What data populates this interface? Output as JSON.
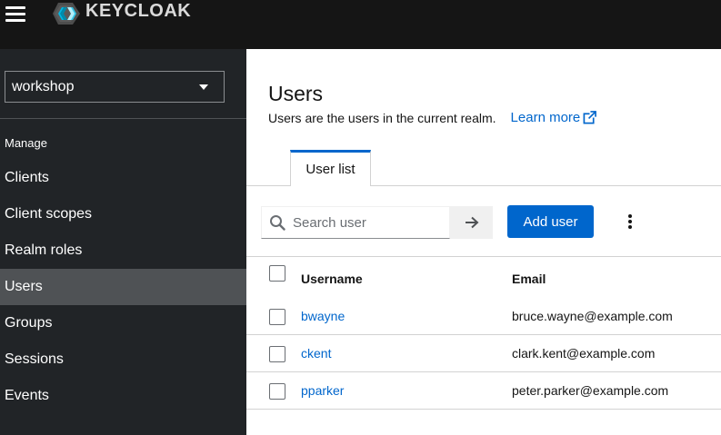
{
  "header": {
    "brand": "KEYCLOAK",
    "colors": {
      "background": "#151515",
      "brand_text": "#dadada"
    }
  },
  "sidebar": {
    "realm": "workshop",
    "section_label": "Manage",
    "items": [
      {
        "label": "Clients",
        "active": false
      },
      {
        "label": "Client scopes",
        "active": false
      },
      {
        "label": "Realm roles",
        "active": false
      },
      {
        "label": "Users",
        "active": true
      },
      {
        "label": "Groups",
        "active": false
      },
      {
        "label": "Sessions",
        "active": false
      },
      {
        "label": "Events",
        "active": false
      }
    ],
    "colors": {
      "background": "#212427",
      "active": "#4f5255"
    }
  },
  "main": {
    "title": "Users",
    "description": "Users are the users in the current realm.",
    "learn_more": "Learn more",
    "tabs": [
      {
        "label": "User list",
        "active": true
      }
    ],
    "toolbar": {
      "search_placeholder": "Search user",
      "add_user_label": "Add user"
    },
    "table": {
      "columns": [
        "Username",
        "Email"
      ],
      "rows": [
        {
          "username": "bwayne",
          "email": "bruce.wayne@example.com"
        },
        {
          "username": "ckent",
          "email": "clark.kent@example.com"
        },
        {
          "username": "pparker",
          "email": "peter.parker@example.com"
        }
      ]
    },
    "colors": {
      "primary": "#0066cc",
      "link": "#0066cc"
    }
  },
  "icons": [
    "menu-icon",
    "keycloak-logo",
    "caret-down-icon",
    "external-link-icon",
    "search-icon",
    "arrow-right-icon",
    "kebab-icon"
  ]
}
